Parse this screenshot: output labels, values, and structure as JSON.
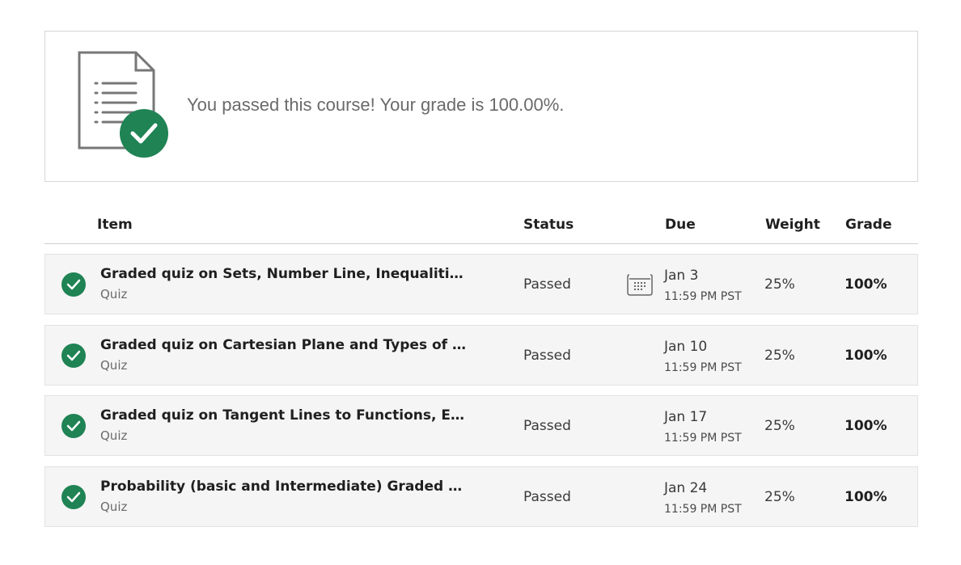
{
  "banner": {
    "message": "You passed this course! Your grade is 100.00%.",
    "icon": "document-check-icon",
    "accent_color": "#1f8354"
  },
  "table": {
    "headers": {
      "item": "Item",
      "status": "Status",
      "due": "Due",
      "weight": "Weight",
      "grade": "Grade"
    },
    "rows": [
      {
        "title": "Graded quiz on Sets, Number Line, Inequalities, Si...",
        "type": "Quiz",
        "status": "Passed",
        "due_date": "Jan 3",
        "due_time": "11:59 PM PST",
        "weight": "25%",
        "grade": "100%",
        "show_calendar_icon": true
      },
      {
        "title": "Graded quiz on Cartesian Plane and Types of Funct...",
        "type": "Quiz",
        "status": "Passed",
        "due_date": "Jan 10",
        "due_time": "11:59 PM PST",
        "weight": "25%",
        "grade": "100%",
        "show_calendar_icon": false
      },
      {
        "title": "Graded quiz on Tangent Lines to Functions, Expone...",
        "type": "Quiz",
        "status": "Passed",
        "due_date": "Jan 17",
        "due_time": "11:59 PM PST",
        "weight": "25%",
        "grade": "100%",
        "show_calendar_icon": false
      },
      {
        "title": "Probability (basic and Intermediate) Graded Quiz",
        "type": "Quiz",
        "status": "Passed",
        "due_date": "Jan 24",
        "due_time": "11:59 PM PST",
        "weight": "25%",
        "grade": "100%",
        "show_calendar_icon": false
      }
    ]
  }
}
